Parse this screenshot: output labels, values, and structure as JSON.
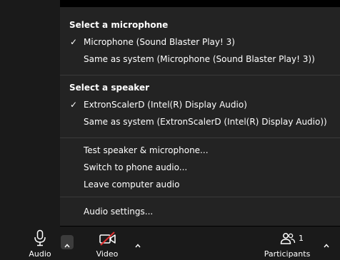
{
  "microphone_section": {
    "header": "Select a microphone",
    "items": [
      {
        "label": "Microphone (Sound Blaster Play! 3)",
        "checked": true
      },
      {
        "label": "Same as system (Microphone (Sound Blaster Play! 3))",
        "checked": false
      }
    ]
  },
  "speaker_section": {
    "header": "Select a speaker",
    "items": [
      {
        "label": "ExtronScalerD (Intel(R) Display Audio)",
        "checked": true
      },
      {
        "label": "Same as system (ExtronScalerD (Intel(R) Display Audio))",
        "checked": false
      }
    ]
  },
  "actions": {
    "items": [
      {
        "label": "Test speaker & microphone..."
      },
      {
        "label": "Switch to phone audio..."
      },
      {
        "label": "Leave computer audio"
      }
    ]
  },
  "settings": {
    "label": "Audio settings..."
  },
  "check_glyph": "✓",
  "toolbar": {
    "audio_label": "Audio",
    "video_label": "Video",
    "participants_label": "Participants",
    "participants_count": "1"
  },
  "icons": {
    "audio": "microphone-icon",
    "video": "video-off-icon",
    "participants": "participants-icon",
    "caret": "chevron-up-icon"
  },
  "colors": {
    "menu_bg": "#232323",
    "toolbar_bg": "#1a1a1a",
    "text": "#ffffff",
    "divider": "#3a3a3a",
    "video_off_slash": "#e02f2f"
  }
}
